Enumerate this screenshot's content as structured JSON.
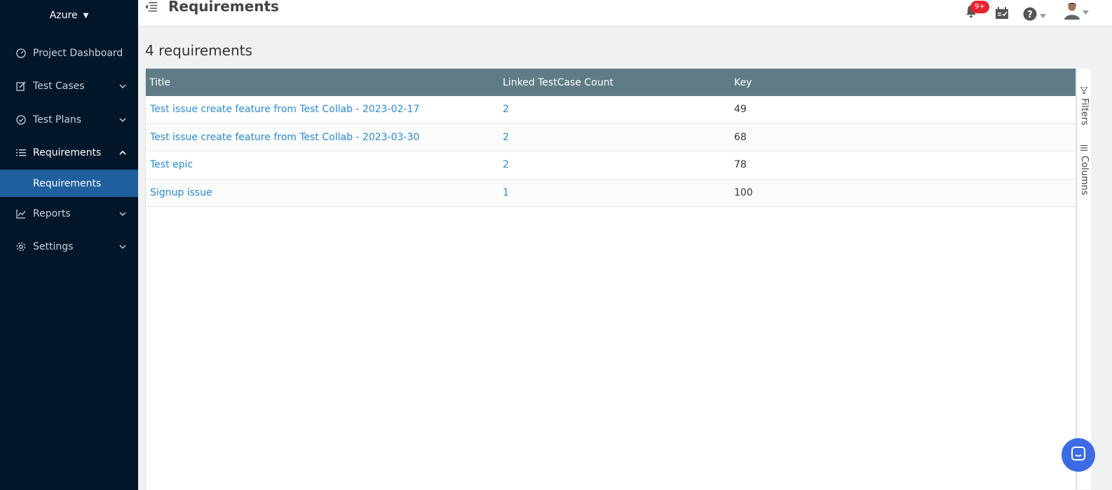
{
  "sidebar": {
    "project_name": "Azure",
    "items": [
      {
        "label": "Project Dashboard",
        "icon": "dashboard-icon"
      },
      {
        "label": "Test Cases",
        "icon": "edit-icon"
      },
      {
        "label": "Test Plans",
        "icon": "check-circle-icon"
      },
      {
        "label": "Requirements",
        "icon": "list-icon"
      },
      {
        "label": "Reports",
        "icon": "chart-icon"
      },
      {
        "label": "Settings",
        "icon": "gear-icon"
      }
    ],
    "active_sub_item": "Requirements"
  },
  "topbar": {
    "title": "Requirements",
    "notification_badge": "9+"
  },
  "main": {
    "count_label": "4 requirements",
    "columns": [
      "Title",
      "Linked TestCase Count",
      "Key"
    ],
    "rows": [
      {
        "title": "Test issue create feature from Test Collab - 2023-02-17",
        "linked": "2",
        "key": "49"
      },
      {
        "title": "Test issue create feature from Test Collab - 2023-03-30",
        "linked": "2",
        "key": "68"
      },
      {
        "title": "Test epic",
        "linked": "2",
        "key": "78"
      },
      {
        "title": "Signup issue",
        "linked": "1",
        "key": "100"
      }
    ]
  },
  "side_panel": {
    "filters_label": "Filters",
    "columns_label": "Columns"
  },
  "colors": {
    "sidebar_bg": "#03172a",
    "active_item_bg": "#1f5f9e",
    "grid_header_bg": "#5f7b86",
    "link": "#2a8bd6",
    "badge": "#e8232f",
    "chat_bubble": "#3d6be5"
  }
}
